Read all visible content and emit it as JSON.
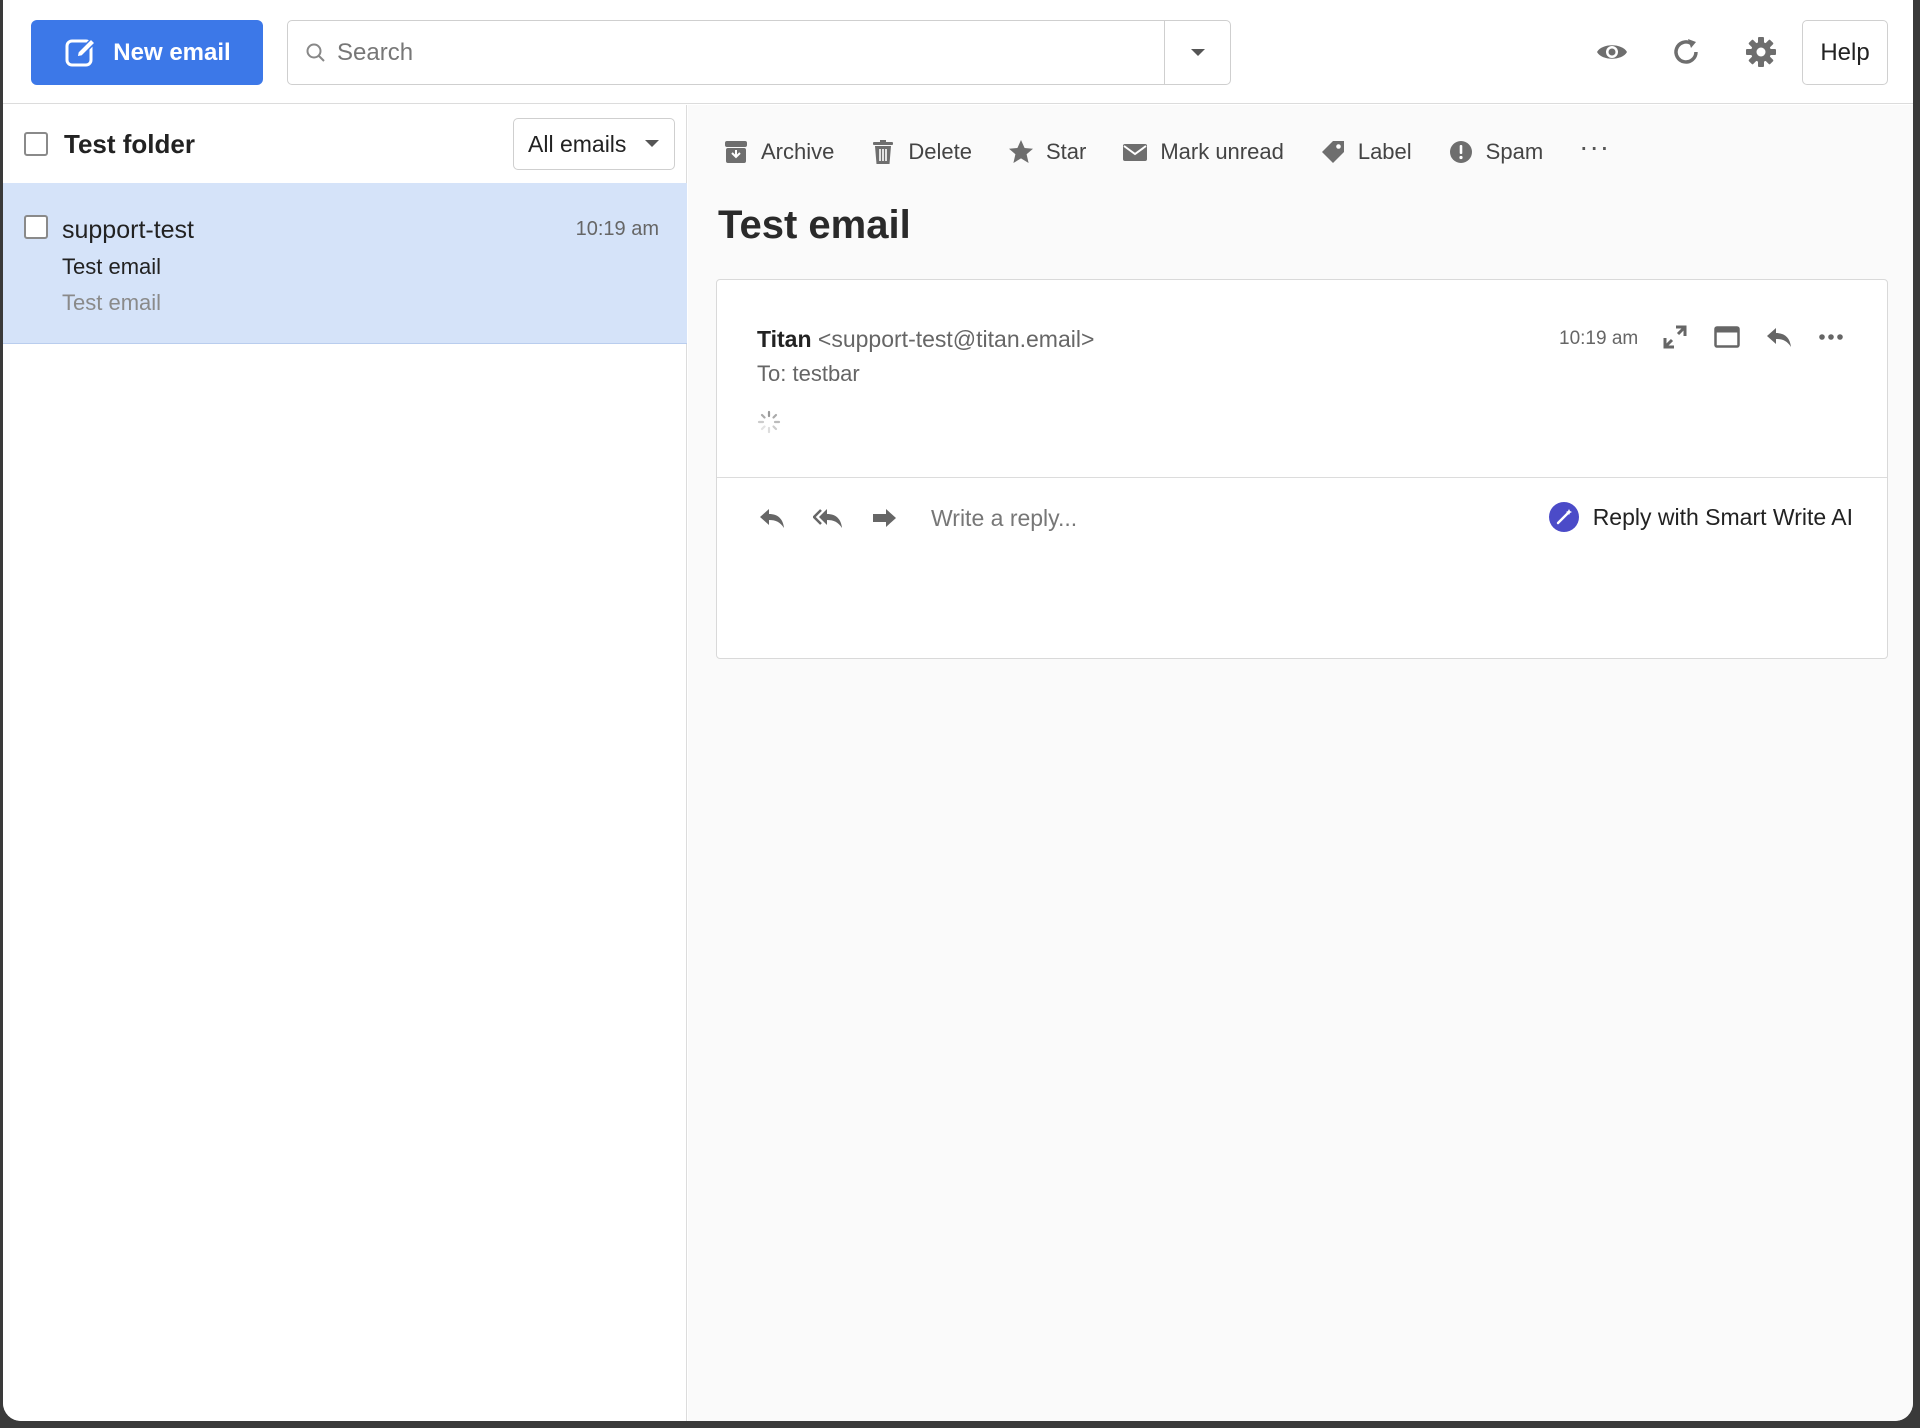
{
  "topbar": {
    "new_email_label": "New email",
    "search_placeholder": "Search",
    "help_label": "Help"
  },
  "folder": {
    "title": "Test folder",
    "filter_value": "All emails"
  },
  "email_list": [
    {
      "sender": "support-test",
      "time": "10:19 am",
      "subject": "Test email",
      "preview": "Test email"
    }
  ],
  "toolbar": {
    "archive": "Archive",
    "delete": "Delete",
    "star": "Star",
    "mark_unread": "Mark unread",
    "label": "Label",
    "spam": "Spam",
    "more": "···"
  },
  "message": {
    "title": "Test email",
    "from_name": "Titan",
    "from_address": "<support-test@titan.email>",
    "to_label": "To:",
    "to_value": "testbar",
    "time": "10:19 am",
    "reply_placeholder": "Write a reply...",
    "smart_ai_label": "Reply with Smart Write AI"
  },
  "colors": {
    "primary": "#3c78e8",
    "selected_row": "#d5e3f9",
    "ai_badge": "#4b4bc8"
  }
}
